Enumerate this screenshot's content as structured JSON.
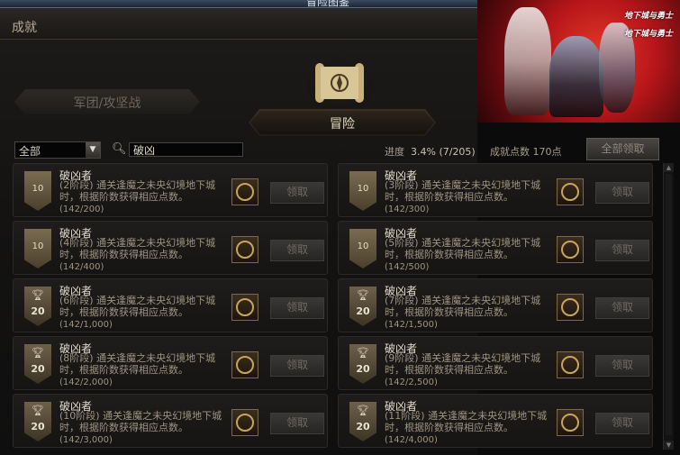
{
  "window": {
    "title": "冒险图鉴"
  },
  "header": {
    "title": "成就"
  },
  "banner": {
    "logo_text": "地下城与勇士"
  },
  "tabs": {
    "legion": "军团/攻坚战",
    "adventure": "冒险"
  },
  "filter": {
    "selected": "全部"
  },
  "search": {
    "value": "破凶"
  },
  "progress": {
    "label": "进度",
    "value": "3.4% (7/205)"
  },
  "points": {
    "label": "成就点数",
    "value": "170点"
  },
  "claim_all_label": "全部领取",
  "achievements": [
    {
      "name": "破凶者",
      "badge": "10",
      "badge_type": "level",
      "desc": "(2阶段) 通关逢魔之未央幻境地下城时，根据阶数获得相应点数。",
      "progress": "(142/200)",
      "claim": "领取"
    },
    {
      "name": "破凶者",
      "badge": "10",
      "badge_type": "level",
      "desc": "(3阶段) 通关逢魔之未央幻境地下城时，根据阶数获得相应点数。",
      "progress": "(142/300)",
      "claim": "领取"
    },
    {
      "name": "破凶者",
      "badge": "10",
      "badge_type": "level",
      "desc": "(4阶段) 通关逢魔之未央幻境地下城时，根据阶数获得相应点数。",
      "progress": "(142/400)",
      "claim": "领取"
    },
    {
      "name": "破凶者",
      "badge": "10",
      "badge_type": "level",
      "desc": "(5阶段) 通关逢魔之未央幻境地下城时，根据阶数获得相应点数。",
      "progress": "(142/500)",
      "claim": "领取"
    },
    {
      "name": "破凶者",
      "badge": "20",
      "badge_type": "trophy",
      "desc": "(6阶段) 通关逢魔之未央幻境地下城时，根据阶数获得相应点数。",
      "progress": "(142/1,000)",
      "claim": "领取"
    },
    {
      "name": "破凶者",
      "badge": "20",
      "badge_type": "trophy",
      "desc": "(7阶段) 通关逢魔之未央幻境地下城时，根据阶数获得相应点数。",
      "progress": "(142/1,500)",
      "claim": "领取"
    },
    {
      "name": "破凶者",
      "badge": "20",
      "badge_type": "trophy",
      "desc": "(8阶段) 通关逢魔之未央幻境地下城时，根据阶数获得相应点数。",
      "progress": "(142/2,000)",
      "claim": "领取"
    },
    {
      "name": "破凶者",
      "badge": "20",
      "badge_type": "trophy",
      "desc": "(9阶段) 通关逢魔之未央幻境地下城时，根据阶数获得相应点数。",
      "progress": "(142/2,500)",
      "claim": "领取"
    },
    {
      "name": "破凶者",
      "badge": "20",
      "badge_type": "trophy",
      "desc": "(10阶段) 通关逢魔之未央幻境地下城时，根据阶数获得相应点数。",
      "progress": "(142/3,000)",
      "claim": "领取"
    },
    {
      "name": "破凶者",
      "badge": "20",
      "badge_type": "trophy",
      "desc": "(11阶段) 通关逢魔之未央幻境地下城时，根据阶数获得相应点数。",
      "progress": "(142/4,000)",
      "claim": "领取"
    }
  ]
}
